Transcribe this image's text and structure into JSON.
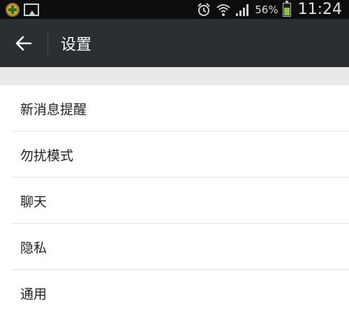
{
  "status_bar": {
    "left_icons": [
      "app-badge-icon",
      "gallery-icon"
    ],
    "right_icons": [
      "alarm-icon",
      "wifi-icon",
      "signal-icon"
    ],
    "battery_percent": "56%",
    "battery_level": 0.56,
    "time": "11:24"
  },
  "action_bar": {
    "back_icon": "arrow-left-icon",
    "title": "设置"
  },
  "settings": {
    "items": [
      {
        "label": "新消息提醒"
      },
      {
        "label": "勿扰模式"
      },
      {
        "label": "聊天"
      },
      {
        "label": "隐私"
      },
      {
        "label": "通用"
      }
    ]
  },
  "colors": {
    "status_bar_bg": "#0d0d0d",
    "action_bar_bg": "#2a2f33",
    "section_gap": "#e9e9e9",
    "battery_green": "#8bc34a"
  }
}
